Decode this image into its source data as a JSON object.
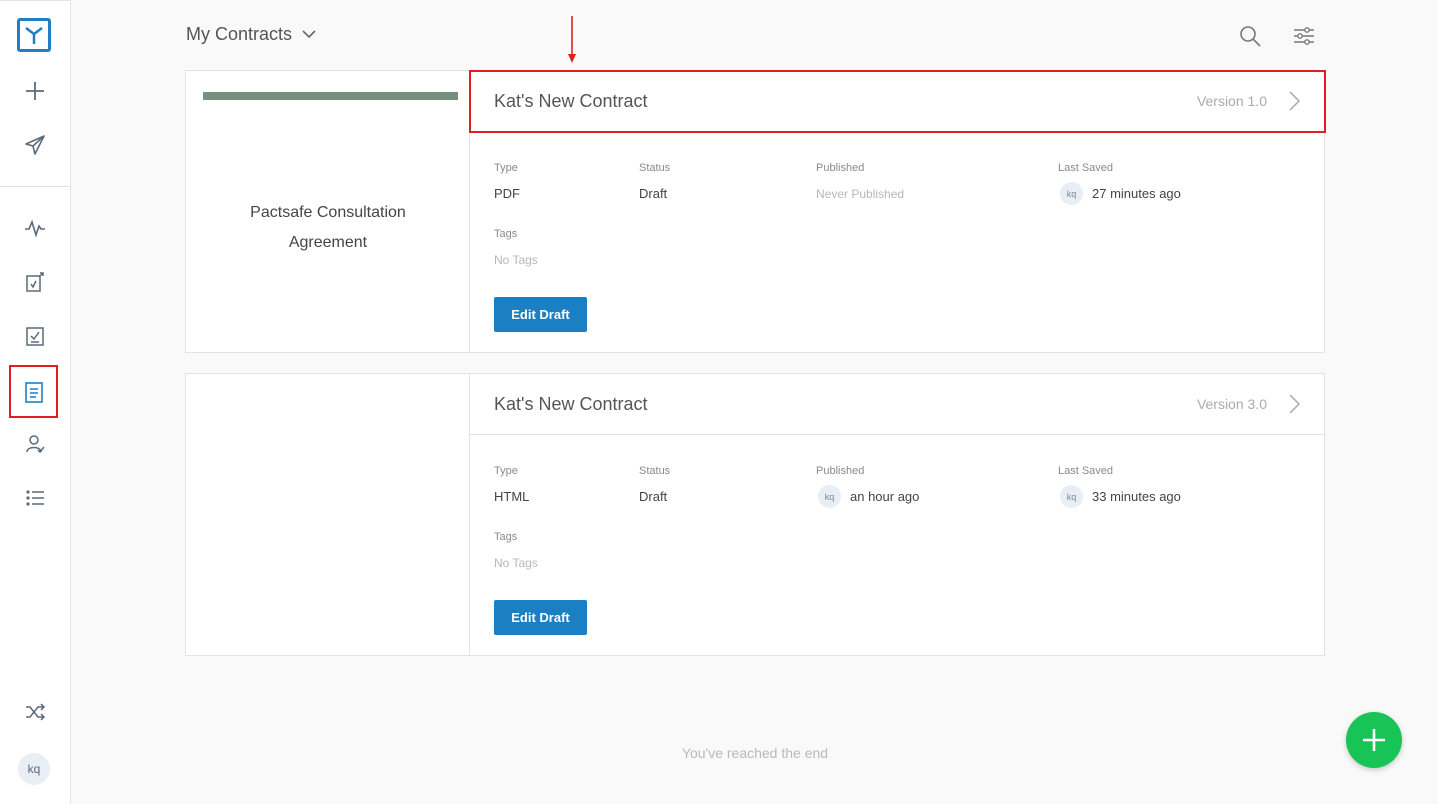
{
  "header": {
    "title": "My Contracts"
  },
  "sidebar": {
    "avatar": "kq",
    "items": [
      "logo-icon",
      "add-icon",
      "send-icon",
      "activity-icon",
      "reports-icon",
      "checklist-icon",
      "contracts-icon",
      "signer-icon",
      "list-icon",
      "shuffle-icon"
    ]
  },
  "contracts": [
    {
      "preview_title": "Pactsafe Consultation Agreement",
      "title": "Kat's New Contract",
      "version": "Version 1.0",
      "type_label": "Type",
      "type": "PDF",
      "status_label": "Status",
      "status": "Draft",
      "published_label": "Published",
      "published": "Never Published",
      "published_avatar": "",
      "saved_label": "Last Saved",
      "saved": "27 minutes ago",
      "saved_avatar": "kq",
      "tags_label": "Tags",
      "tags": "No Tags",
      "button": "Edit Draft"
    },
    {
      "preview_title": "",
      "title": "Kat's New Contract",
      "version": "Version 3.0",
      "type_label": "Type",
      "type": "HTML",
      "status_label": "Status",
      "status": "Draft",
      "published_label": "Published",
      "published": "an hour ago",
      "published_avatar": "kq",
      "saved_label": "Last Saved",
      "saved": "33 minutes ago",
      "saved_avatar": "kq",
      "tags_label": "Tags",
      "tags": "No Tags",
      "button": "Edit Draft"
    }
  ],
  "footer": {
    "end_text": "You've reached the end"
  },
  "colors": {
    "accent": "#1b7fc3",
    "fab": "#19c457",
    "highlight": "#e02020"
  }
}
